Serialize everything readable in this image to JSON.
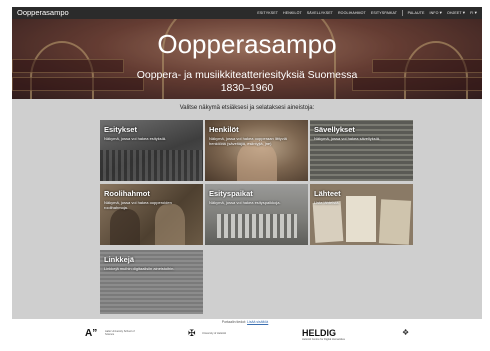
{
  "app_title": "Oopperasampo",
  "nav": {
    "items": [
      "Esitykset",
      "Henkilöt",
      "Sävellykset",
      "Roolihahmot",
      "Esityspaikat"
    ],
    "feedback": "Palaute",
    "info": "Info",
    "help": "Ohjeet",
    "lang": "FI"
  },
  "hero": {
    "title": "Oopperasampo",
    "subtitle_line1": "Ooppera- ja musiikkiteatteriesityksiä Suomessa",
    "subtitle_line2": "1830–1960"
  },
  "prompt": "Valitse näkymä etsiäksesi ja selataksesi aineistoja:",
  "tiles": [
    {
      "title": "Esitykset",
      "desc": "Näkymä, jossa voi hakea esityksiä."
    },
    {
      "title": "Henkilöt",
      "desc": "Näkymä, jossa voi hakea oopperaan liittyviä henkilöitä (säveltäjiä, esiintyjiä, jne)"
    },
    {
      "title": "Sävellykset",
      "desc": "Näkymä, jossa voi hakea sävellyksiä."
    },
    {
      "title": "Roolihahmot",
      "desc": "Näkymä, jossa voi hakea oopperoiden roolihahmoja."
    },
    {
      "title": "Esityspaikat",
      "desc": "Näkymä, jossa voi hakea esityspaikkoja."
    },
    {
      "title": "Lähteet",
      "desc": "Lista lähteistä."
    },
    {
      "title": "Linkkejä",
      "desc": "Linkkejä muihin digitaalisiin aineistoihin."
    }
  ],
  "footer": {
    "note": "Portaalin tiedot:",
    "link": "Lisää sisältöä",
    "logos": [
      {
        "name": "Aalto University",
        "sub": "Aalto University School of Science"
      },
      {
        "name": "",
        "sub": "University of Helsinki"
      },
      {
        "name": "HELDIG",
        "sub": "Helsinki Centre for Digital Humanities"
      },
      {
        "name": "",
        "sub": ""
      }
    ]
  }
}
